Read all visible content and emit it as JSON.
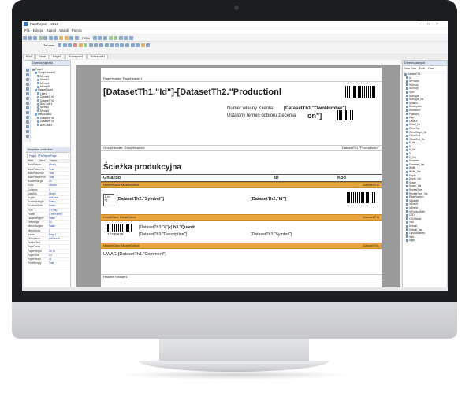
{
  "app": {
    "title": "FastReport - 4519",
    "menu": [
      "Plik",
      "Edycja",
      "Raport",
      "Widok",
      "Pomoc"
    ],
    "zoom": "100%",
    "font_box": "Tahoma",
    "tabs": [
      "Kod",
      "Dane",
      "Page1",
      "Subreport1",
      "Subreport1"
    ]
  },
  "left_panel": {
    "header": "Drzewo raportu",
    "tree": [
      "Page1",
      "GroupHeader1",
      "Memo1",
      "Memo2",
      "Memo4",
      "Memo25",
      "MasterData1",
      "Line1",
      "DatasetTh2",
      "DatasetTh2",
      "BarCode1",
      "Memo2",
      "Memo3",
      "DetailData1",
      "DatasetTh3",
      "DatasetTh3",
      "BarCode3"
    ]
  },
  "inspector": {
    "header": "Inspektor obiektów",
    "object": "Page1: TFrxReportPage",
    "tabs": [
      "Właś...",
      "Zdarz...",
      "Favori..."
    ],
    "props": [
      [
        "BackPicture",
        "(Brak)"
      ],
      [
        "BackPictureVis",
        "True"
      ],
      [
        "BackPictureAv",
        "True"
      ],
      [
        "BackPicturePrin",
        "True"
      ],
      [
        "BottomMargin",
        "10"
      ],
      [
        "Color",
        "clNone"
      ],
      [
        "Columns",
        "0"
      ],
      [
        "DataSet",
        "(Brak)"
      ],
      [
        "Duplex",
        "dmNone"
      ],
      [
        "EndlessHeight",
        "False"
      ],
      [
        "EndlessWidth",
        "False"
      ],
      [
        "Font",
        "(TFont)"
      ],
      [
        "Frame",
        "(TfrxFrame)"
      ],
      [
        "LargeDesignH",
        "False"
      ],
      [
        "LeftMargin",
        "10"
      ],
      [
        "MirrorMargins",
        "False"
      ],
      [
        "MirrorMode",
        "[]"
      ],
      [
        "Name",
        "Page1"
      ],
      [
        "Orientation",
        "poPortrait"
      ],
      [
        "OutlineText",
        ""
      ],
      [
        "PageCount",
        "1"
      ],
      [
        "PaperHeight",
        "29,70"
      ],
      [
        "PaperSize",
        "A4"
      ],
      [
        "PaperWidth",
        "21"
      ],
      [
        "PrintIfEmpty",
        "True"
      ]
    ]
  },
  "report": {
    "page_header": "PageHeader: PageHeader1",
    "title_expr": "[DatasetTh1.\"Id\"]-[DatasetTh2.\"Productionl",
    "owner_label": "Numer własny Klienta:",
    "owner_value": "[DatasetTh1.\"OwnNumber\"]",
    "term_label": "Ustalony termin odbioru zlecenia:",
    "term_value": "on\"]",
    "group_header": "GroupHeader: GroupHeader1",
    "group_right": "DatasetTh1.\"ProductionId\"",
    "section_title": "Ścieżka produkcyjna",
    "col_headers": [
      "Gniazdo",
      "ID",
      "Kod"
    ],
    "master_band": "MasterData: MasterData1",
    "master_right": "DatasetTh2",
    "line_label": "[Lin\ne]",
    "symbol_expr": "[DatasetTh2.\"Symbol\"]",
    "id_expr": "[DatasetTh2.\"Id\"]",
    "detail_band": "DetailData: DetailData1",
    "detail_right": "DatasetTh3",
    "qty_expr": "[DatasetTh3.\"X\"]x[",
    "qty_expr2": "h3.\"Quantit",
    "barcode_num": "12345678",
    "desc_expr": "[DatasetTh3.\"Description\"]",
    "sym3_expr": "[DatasetTh3.\"Symbol\"]",
    "master5_band": "MasterData: MasterData5",
    "master5_right": "DatasetTh1",
    "comment_label": "UWAGI:",
    "comment_expr": "[DatasetTh1.\"Comment\"]",
    "header_band": "Header: Header1"
  },
  "right_panel": {
    "header": "Drzewo danych",
    "tabs": [
      "Dane",
      "Zmie...",
      "Funk...",
      "Class..."
    ],
    "root": "DatasetTh1",
    "fields": [
      "Id",
      "IdProces",
      "IdGroup",
      "IdGroup",
      "Sym",
      "SubType",
      "SubType_Nk",
      "Symbol",
      "Description",
      "DirectionY",
      "PositionX",
      "Align",
      "OffsetX",
      "Offset_Nk",
      "OffsetTop",
      "OffsetBegin_Nk",
      "OffsetEnd",
      "OffsetEnd_Nk",
      "K_Int",
      "K",
      "K_Val",
      "D",
      "D_Val",
      "Diameter",
      "Diameter_Val",
      "Width",
      "Width_Val",
      "Depth",
      "Depth_Val",
      "Space",
      "Space_Val",
      "RepeatType",
      "RepeatType_Val",
      "EdgeNumber",
      "IdBorder",
      "IdEvent",
      "IdBrand",
      "IdProductSide",
      "CED",
      "CEDBrand",
      "Tool",
      "Default",
      "Default_Val",
      "LandVariables",
      "Idtor1",
      "Align"
    ]
  }
}
